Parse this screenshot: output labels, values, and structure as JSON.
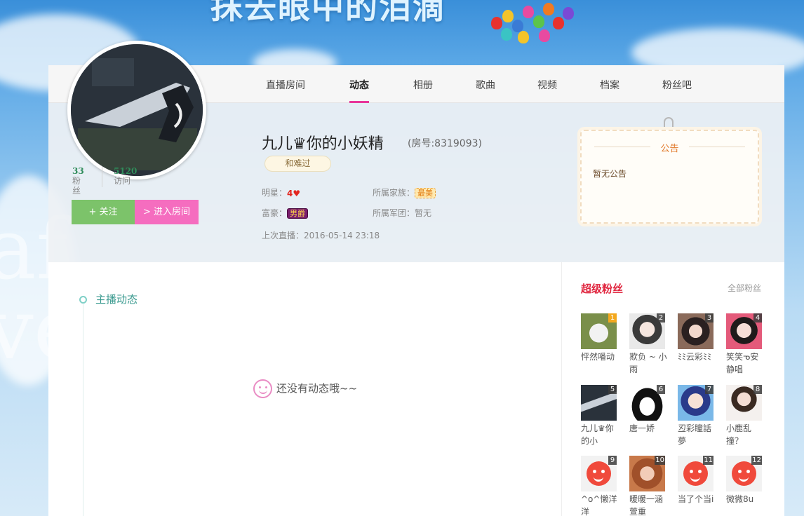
{
  "banner": {
    "title": "抹去眼中的泪滴"
  },
  "nav": {
    "items": [
      {
        "label": "直播房间",
        "active": false
      },
      {
        "label": "动态",
        "active": true
      },
      {
        "label": "相册",
        "active": false
      },
      {
        "label": "歌曲",
        "active": false
      },
      {
        "label": "视频",
        "active": false
      },
      {
        "label": "档案",
        "active": false
      },
      {
        "label": "粉丝吧",
        "active": false
      }
    ]
  },
  "profile": {
    "avatar_icon": "pistol-avatar",
    "fans_count": "33",
    "fans_label": "粉丝",
    "visits_count": "5120",
    "visits_label": "访问",
    "follow_label": "+ 关注",
    "enter_room_label": "> 进入房间",
    "name": "九儿♛你的小妖精",
    "room_number": "(房号:8319093)",
    "tag": "和难过",
    "star_label": "明星：",
    "star_level": "4",
    "rich_label": "富豪：",
    "rich_badge": "男爵",
    "family_label": "所属家族：",
    "family_badge": "最美",
    "army_label": "所属军团：暂无",
    "last_live": "上次直播：2016-05-14 23:18"
  },
  "notice": {
    "title": "公告",
    "body": "暂无公告"
  },
  "timeline": {
    "title": "主播动态",
    "empty_text": "还没有动态哦~~"
  },
  "super_fans": {
    "title": "超级粉丝",
    "all_link": "全部粉丝",
    "fans": [
      {
        "rank": "1",
        "name": "怦然噃动",
        "avatar": "cat-photo"
      },
      {
        "rank": "2",
        "name": "欺负 ~ 小雨",
        "avatar": "girl-photo"
      },
      {
        "rank": "3",
        "name": "ﾐﾐ云彩ﾐﾐ",
        "avatar": "girl-photo"
      },
      {
        "rank": "4",
        "name": "笑笑ᓀ安静唱",
        "avatar": "girl-photo"
      },
      {
        "rank": "5",
        "name": "九儿♛你的小",
        "avatar": "pistol-photo"
      },
      {
        "rank": "6",
        "name": "唐一娇",
        "avatar": "penguin-icon"
      },
      {
        "rank": "7",
        "name": "丒彩瞳話夢",
        "avatar": "girl-photo"
      },
      {
        "rank": "8",
        "name": "小鹿乱撞？",
        "avatar": "girl-photo"
      },
      {
        "rank": "9",
        "name": "^o^懒洋洋",
        "avatar": "default-face-icon"
      },
      {
        "rank": "10",
        "name": "暖暖一涵萱重",
        "avatar": "doll-photo"
      },
      {
        "rank": "11",
        "name": "当了个当i",
        "avatar": "default-face-icon"
      },
      {
        "rank": "12",
        "name": "微微8u",
        "avatar": "default-face-icon"
      }
    ]
  }
}
